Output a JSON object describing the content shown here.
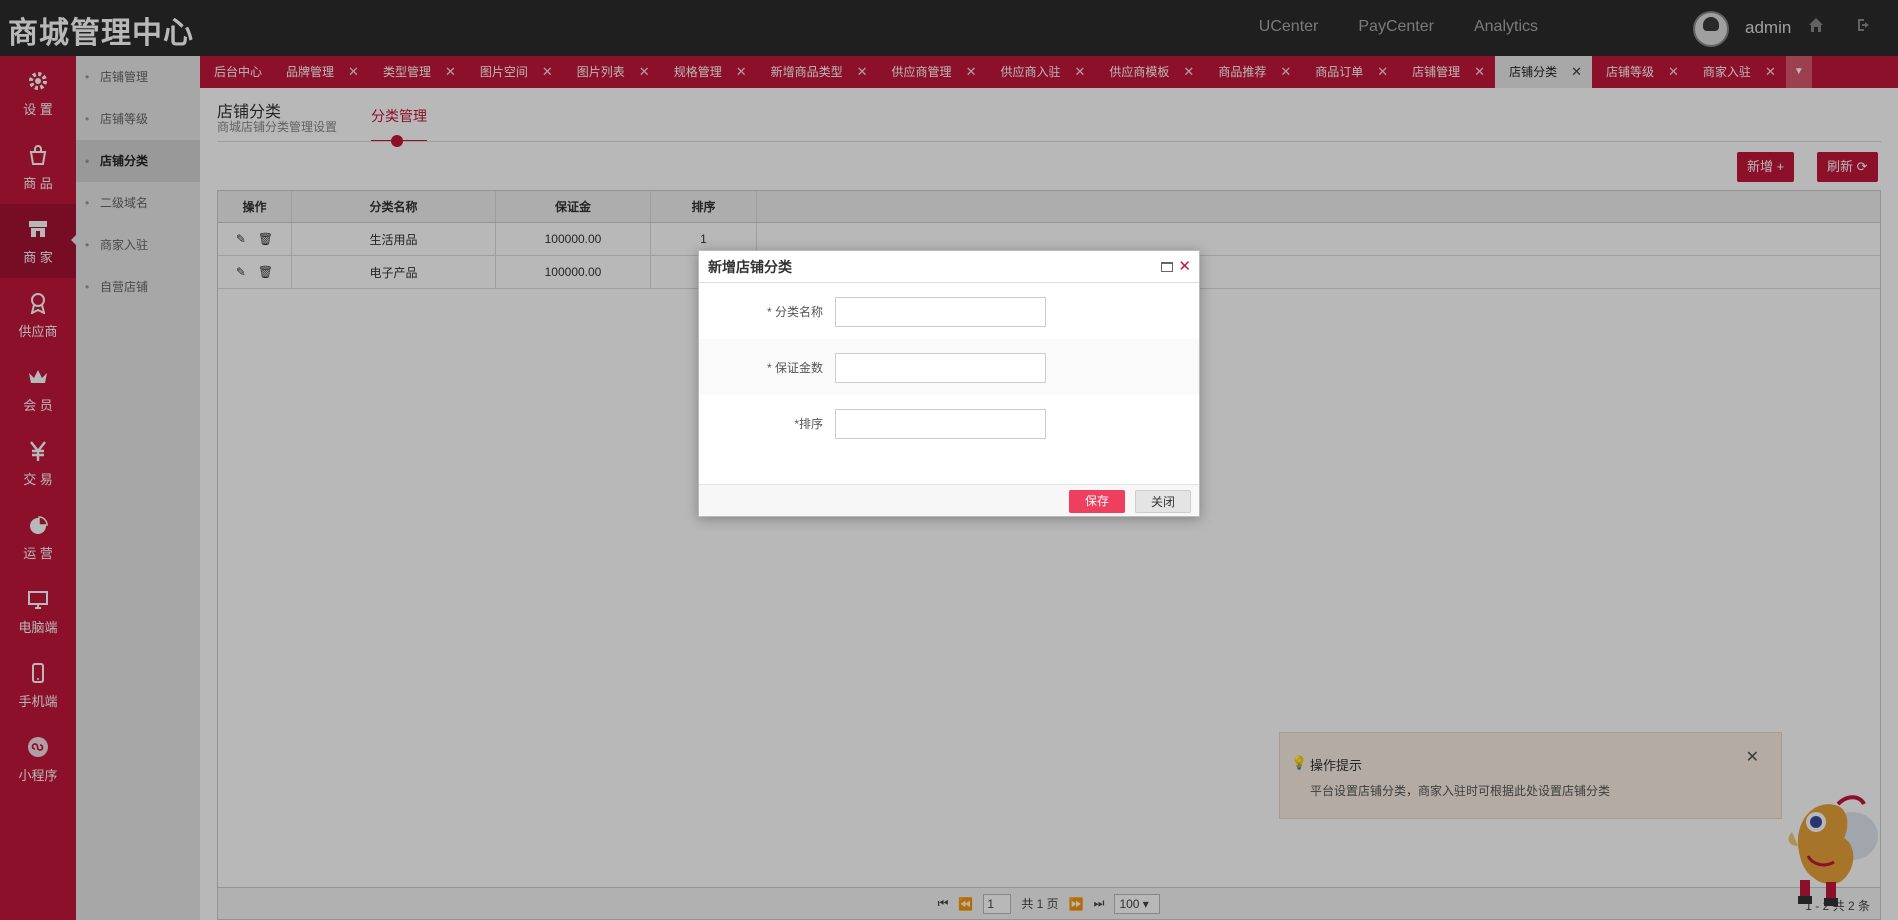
{
  "brand": "商城管理中心",
  "top_links": [
    "UCenter",
    "PayCenter",
    "Analytics"
  ],
  "user": "admin",
  "left_nav": [
    {
      "label": "设 置",
      "icon": "gear-icon"
    },
    {
      "label": "商 品",
      "icon": "bag-icon"
    },
    {
      "label": "商 家",
      "icon": "store-icon",
      "active": true
    },
    {
      "label": "供应商",
      "icon": "medal-icon"
    },
    {
      "label": "会 员",
      "icon": "crown-icon"
    },
    {
      "label": "交 易",
      "icon": "yen-icon"
    },
    {
      "label": "运 营",
      "icon": "pie-chart-icon"
    },
    {
      "label": "电脑端",
      "icon": "monitor-icon"
    },
    {
      "label": "手机端",
      "icon": "phone-icon"
    },
    {
      "label": "小程序",
      "icon": "mini-program-icon"
    }
  ],
  "sub_nav": [
    {
      "label": "店铺管理"
    },
    {
      "label": "店铺等级"
    },
    {
      "label": "店铺分类",
      "active": true
    },
    {
      "label": "二级域名"
    },
    {
      "label": "商家入驻"
    },
    {
      "label": "自营店铺"
    }
  ],
  "tabs": [
    {
      "label": "后台中心",
      "close": false
    },
    {
      "label": "品牌管理",
      "close": true
    },
    {
      "label": "类型管理",
      "close": true
    },
    {
      "label": "图片空间",
      "close": true
    },
    {
      "label": "图片列表",
      "close": true
    },
    {
      "label": "规格管理",
      "close": true
    },
    {
      "label": "新增商品类型",
      "close": true
    },
    {
      "label": "供应商管理",
      "close": true
    },
    {
      "label": "供应商入驻",
      "close": true
    },
    {
      "label": "供应商模板",
      "close": true
    },
    {
      "label": "商品推荐",
      "close": true
    },
    {
      "label": "商品订单",
      "close": true
    },
    {
      "label": "店铺管理",
      "close": true
    },
    {
      "label": "店铺分类",
      "close": true,
      "active": true
    },
    {
      "label": "店铺等级",
      "close": true
    },
    {
      "label": "商家入驻",
      "close": true
    }
  ],
  "page": {
    "title": "店铺分类",
    "subtitle": "商城店铺分类管理设置",
    "tab": "分类管理",
    "add_button": "新增",
    "refresh_button": "刷新"
  },
  "grid": {
    "columns": [
      "操作",
      "分类名称",
      "保证金",
      "排序"
    ],
    "rows": [
      {
        "name": "生活用品",
        "deposit": "100000.00",
        "order": "1"
      },
      {
        "name": "电子产品",
        "deposit": "100000.00",
        "order": "2"
      }
    ],
    "pager": {
      "page": "1",
      "total_pages": "共 1 页",
      "page_size": "100",
      "info": "1 - 2 共 2 条"
    }
  },
  "dialog": {
    "title": "新增店铺分类",
    "fields": [
      {
        "label": "* 分类名称",
        "value": ""
      },
      {
        "label": "* 保证金数",
        "value": ""
      },
      {
        "label": "*排序",
        "value": ""
      }
    ],
    "save": "保存",
    "close": "关闭"
  },
  "tip": {
    "title": "操作提示",
    "text": "平台设置店铺分类，商家入驻时可根据此处设置店铺分类"
  },
  "colors": {
    "brand_red": "#c2173b",
    "topbar": "#2b2b2b",
    "save_button": "#ef3f5e"
  }
}
